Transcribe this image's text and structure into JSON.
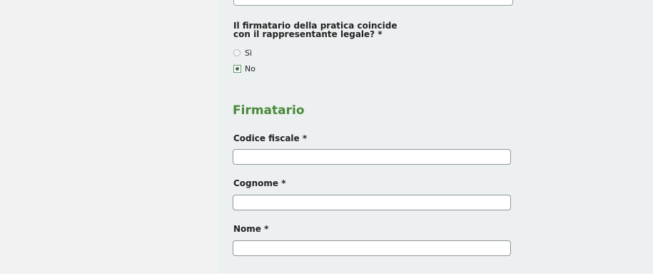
{
  "question": {
    "line1": "Il firmatario della pratica coincide",
    "line2": "con il rappresentante legale? *"
  },
  "radio_options": [
    {
      "label": "Sì",
      "selected": false
    },
    {
      "label": "No",
      "selected": true
    }
  ],
  "section_title": "Firmatario",
  "fields": {
    "codice_fiscale": {
      "label": "Codice fiscale *",
      "value": ""
    },
    "cognome": {
      "label": "Cognome *",
      "value": ""
    },
    "nome": {
      "label": "Nome *",
      "value": ""
    }
  },
  "colors": {
    "panel_bg": "#ecf0f1",
    "side_bg": "#f2f2f2",
    "section_title": "#4a8a3c"
  }
}
